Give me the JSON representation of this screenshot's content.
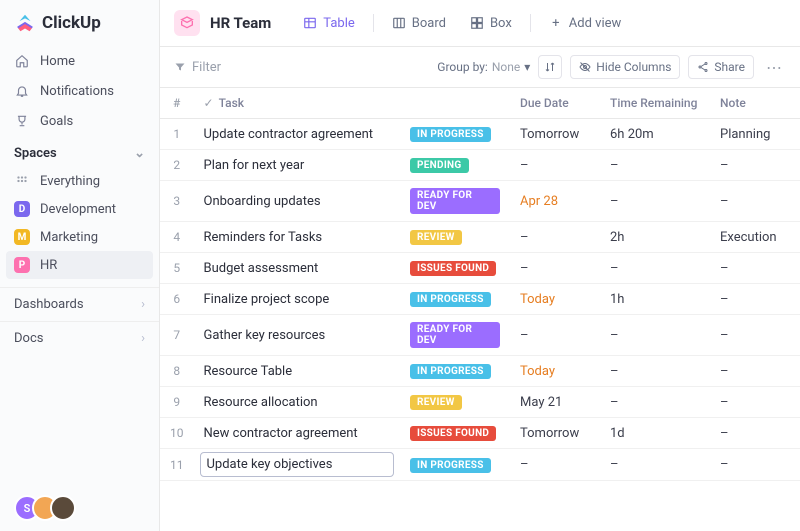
{
  "brand": "ClickUp",
  "nav": {
    "home": "Home",
    "notifications": "Notifications",
    "goals": "Goals"
  },
  "spaces": {
    "header": "Spaces",
    "everything": "Everything",
    "items": [
      {
        "letter": "D",
        "label": "Development"
      },
      {
        "letter": "M",
        "label": "Marketing"
      },
      {
        "letter": "P",
        "label": "HR"
      }
    ]
  },
  "footer": {
    "dashboards": "Dashboards",
    "docs": "Docs"
  },
  "header": {
    "team_name": "HR Team",
    "views": {
      "table": "Table",
      "board": "Board",
      "box": "Box",
      "add": "Add view"
    }
  },
  "toolbar": {
    "filter": "Filter",
    "group_by_label": "Group by:",
    "group_by_value": "None",
    "hide_cols": "Hide Columns",
    "share": "Share"
  },
  "columns": {
    "idx": "#",
    "task": "Task",
    "due": "Due Date",
    "time": "Time Remaining",
    "note": "Note"
  },
  "statuses": {
    "inprogress": "IN PROGRESS",
    "pending": "PENDING",
    "ready": "READY FOR DEV",
    "review": "REVIEW",
    "issues": "ISSUES FOUND"
  },
  "rows": [
    {
      "n": "1",
      "task": "Update contractor agreement",
      "status": "inprogress",
      "due": "Tomorrow",
      "due_cls": "",
      "time": "6h 20m",
      "note": "Planning"
    },
    {
      "n": "2",
      "task": "Plan for next year",
      "status": "pending",
      "due": "–",
      "due_cls": "",
      "time": "–",
      "note": "–"
    },
    {
      "n": "3",
      "task": "Onboarding updates",
      "status": "ready",
      "due": "Apr 28",
      "due_cls": "due-orange",
      "time": "–",
      "note": "–"
    },
    {
      "n": "4",
      "task": "Reminders for Tasks",
      "status": "review",
      "due": "–",
      "due_cls": "",
      "time": "2h",
      "note": "Execution"
    },
    {
      "n": "5",
      "task": "Budget assessment",
      "status": "issues",
      "due": "–",
      "due_cls": "",
      "time": "–",
      "note": "–"
    },
    {
      "n": "6",
      "task": "Finalize project scope",
      "status": "inprogress",
      "due": "Today",
      "due_cls": "due-orange",
      "time": "1h",
      "note": "–"
    },
    {
      "n": "7",
      "task": "Gather key resources",
      "status": "ready",
      "due": "–",
      "due_cls": "",
      "time": "–",
      "note": "–"
    },
    {
      "n": "8",
      "task": "Resource Table",
      "status": "inprogress",
      "due": "Today",
      "due_cls": "due-orange",
      "time": "–",
      "note": "–"
    },
    {
      "n": "9",
      "task": "Resource allocation",
      "status": "review",
      "due": "May 21",
      "due_cls": "",
      "time": "–",
      "note": "–"
    },
    {
      "n": "10",
      "task": "New contractor agreement",
      "status": "issues",
      "due": "Tomorrow",
      "due_cls": "",
      "time": "1d",
      "note": "–"
    },
    {
      "n": "11",
      "task": "Update key objectives",
      "status": "inprogress",
      "due": "–",
      "due_cls": "",
      "time": "–",
      "note": "–",
      "editing": true
    }
  ],
  "avatars": [
    {
      "bg": "#9b6dff",
      "txt": "S"
    },
    {
      "bg": "#f2a654",
      "txt": ""
    },
    {
      "bg": "#3b3e4c",
      "txt": ""
    }
  ]
}
